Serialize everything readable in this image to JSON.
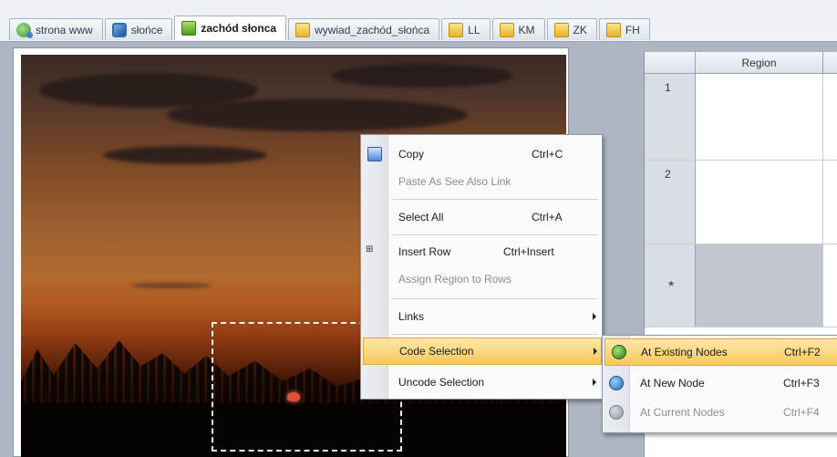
{
  "tabs": [
    {
      "label": "strona www",
      "icon": "web-page-icon"
    },
    {
      "label": "słońce",
      "icon": "picture-icon"
    },
    {
      "label": "zachód słonca",
      "icon": "document-icon",
      "active": true
    },
    {
      "label": "wywiad_zachód_słońca",
      "icon": "folder-icon"
    },
    {
      "label": "LL",
      "icon": "folder-icon"
    },
    {
      "label": "KM",
      "icon": "folder-icon"
    },
    {
      "label": "ZK",
      "icon": "folder-icon"
    },
    {
      "label": "FH",
      "icon": "folder-icon"
    }
  ],
  "grid": {
    "column_header": "Region",
    "rows": [
      {
        "number": "1",
        "region": ""
      },
      {
        "number": "2",
        "region": ""
      }
    ],
    "new_row_marker": "*"
  },
  "context_menu": {
    "items": [
      {
        "label": "Copy",
        "shortcut": "Ctrl+C",
        "enabled": true,
        "icon": "copy-icon"
      },
      {
        "label": "Paste As See Also Link",
        "shortcut": "",
        "enabled": false
      },
      {
        "label": "Select All",
        "shortcut": "Ctrl+A",
        "enabled": true
      },
      {
        "label": "Insert Row",
        "shortcut": "Ctrl+Insert",
        "enabled": true,
        "icon": "insert-row-icon"
      },
      {
        "label": "Assign Region to Rows",
        "shortcut": "",
        "enabled": false
      },
      {
        "label": "Links",
        "shortcut": "",
        "enabled": true,
        "submenu": true
      },
      {
        "label": "Code Selection",
        "shortcut": "",
        "enabled": true,
        "submenu": true,
        "highlighted": true
      },
      {
        "label": "Uncode Selection",
        "shortcut": "",
        "enabled": true,
        "submenu": true
      }
    ]
  },
  "submenu": {
    "items": [
      {
        "label": "At Existing Nodes",
        "shortcut": "Ctrl+F2",
        "enabled": true,
        "highlighted": true
      },
      {
        "label": "At New Node",
        "shortcut": "Ctrl+F3",
        "enabled": true
      },
      {
        "label": "At Current Nodes",
        "shortcut": "Ctrl+F4",
        "enabled": false
      }
    ]
  },
  "colors": {
    "highlight": "#f6c85c",
    "menu_background": "#fbfbfc",
    "chrome": "#aeb6c3"
  }
}
